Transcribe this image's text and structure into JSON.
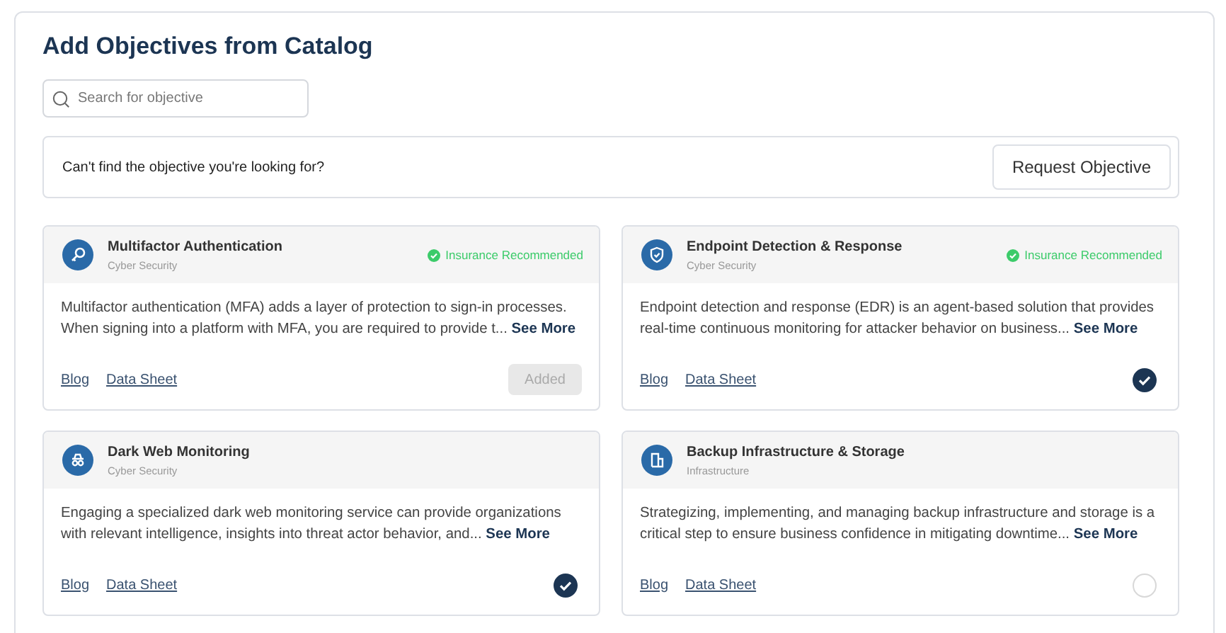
{
  "title": "Add Objectives from Catalog",
  "search": {
    "placeholder": "Search for objective"
  },
  "request": {
    "prompt": "Can't find the objective you're looking for?",
    "button": "Request Objective"
  },
  "cards": [
    {
      "name": "Multifactor Authentication",
      "category": "Cyber Security",
      "badge": "Insurance Recommended",
      "description": "Multifactor authentication (MFA) adds a layer of protection to sign-in processes. When signing into a platform with MFA, you are required to provide t...",
      "more": "See More",
      "links": [
        "Blog",
        "Data Sheet"
      ],
      "action": {
        "kind": "button",
        "label": "Added",
        "disabled": true
      }
    },
    {
      "name": "Endpoint Detection & Response",
      "category": "Cyber Security",
      "badge": "Insurance Recommended",
      "description": "Endpoint detection and response (EDR) is an agent-based solution that provides real-time continuous monitoring for attacker behavior on business...",
      "more": "See More",
      "links": [
        "Blog",
        "Data Sheet"
      ],
      "action": {
        "kind": "check",
        "selected": true
      }
    },
    {
      "name": "Dark Web Monitoring",
      "category": "Cyber Security",
      "description": "Engaging a specialized dark web monitoring service can provide organizations with relevant intelligence, insights into threat actor behavior, and...",
      "more": "See More",
      "links": [
        "Blog",
        "Data Sheet"
      ],
      "action": {
        "kind": "check",
        "selected": true
      }
    },
    {
      "name": "Backup Infrastructure & Storage",
      "category": "Infrastructure",
      "description": "Strategizing, implementing, and managing backup infrastructure and storage is a critical step to ensure business confidence in mitigating downtime...",
      "more": "See More",
      "links": [
        "Blog",
        "Data Sheet"
      ],
      "action": {
        "kind": "check",
        "selected": false
      }
    }
  ]
}
